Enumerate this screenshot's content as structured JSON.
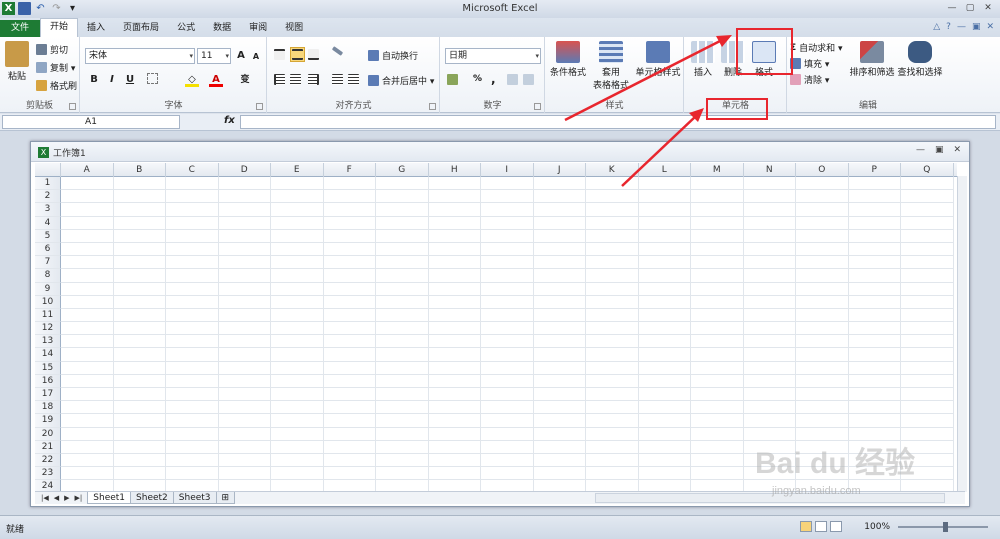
{
  "app_title": "Microsoft Excel",
  "window_buttons": [
    "—",
    "▢",
    "✕"
  ],
  "tabs": [
    {
      "label": "文件"
    },
    {
      "label": "开始"
    },
    {
      "label": "插入"
    },
    {
      "label": "页面布局"
    },
    {
      "label": "公式"
    },
    {
      "label": "数据"
    },
    {
      "label": "审阅"
    },
    {
      "label": "视图"
    }
  ],
  "ribbon": {
    "clipboard": {
      "label": "剪贴板",
      "paste": "粘贴",
      "cut": "剪切",
      "copy": "复制 ▾",
      "format_painter": "格式刷"
    },
    "font": {
      "label": "字体",
      "font_name": "宋体",
      "font_size": "11",
      "bold": "B",
      "italic": "I",
      "underline": "U",
      "grow": "A",
      "shrink": "A",
      "wen": "变"
    },
    "alignment": {
      "label": "对齐方式",
      "wrap": "自动换行",
      "merge": "合并后居中 ▾"
    },
    "number": {
      "label": "数字",
      "format": "日期",
      "percent": "%",
      "comma": ","
    },
    "styles": {
      "label": "样式",
      "conditional": "条件格式",
      "table_line1": "套用",
      "table_line2": "表格格式",
      "cell_styles": "单元格样式"
    },
    "cells": {
      "label": "单元格",
      "insert": "插入",
      "delete": "删除",
      "format": "格式"
    },
    "editing": {
      "label": "编辑",
      "autosum": "自动求和 ▾",
      "fill": "填充 ▾",
      "clear": "清除 ▾",
      "sort": "排序和筛选",
      "find": "查找和选择"
    }
  },
  "formula_bar": {
    "name_box": "A1",
    "fx": "fx"
  },
  "workbook": {
    "title": "工作簿1"
  },
  "columns": [
    "A",
    "B",
    "C",
    "D",
    "E",
    "F",
    "G",
    "H",
    "I",
    "J",
    "K",
    "L",
    "M",
    "N",
    "O",
    "P",
    "Q"
  ],
  "rows": [
    "1",
    "2",
    "3",
    "4",
    "5",
    "6",
    "7",
    "8",
    "9",
    "10",
    "11",
    "12",
    "13",
    "14",
    "15",
    "16",
    "17",
    "18",
    "19",
    "20",
    "21",
    "22",
    "23",
    "24"
  ],
  "sheets": [
    "Sheet1",
    "Sheet2",
    "Sheet3"
  ],
  "status": {
    "ready": "就绪",
    "zoom": "100%"
  },
  "watermark": {
    "logo": "Bai du 经验",
    "url": "jingyan.baidu.com"
  },
  "annotation_color": "#e8262e"
}
